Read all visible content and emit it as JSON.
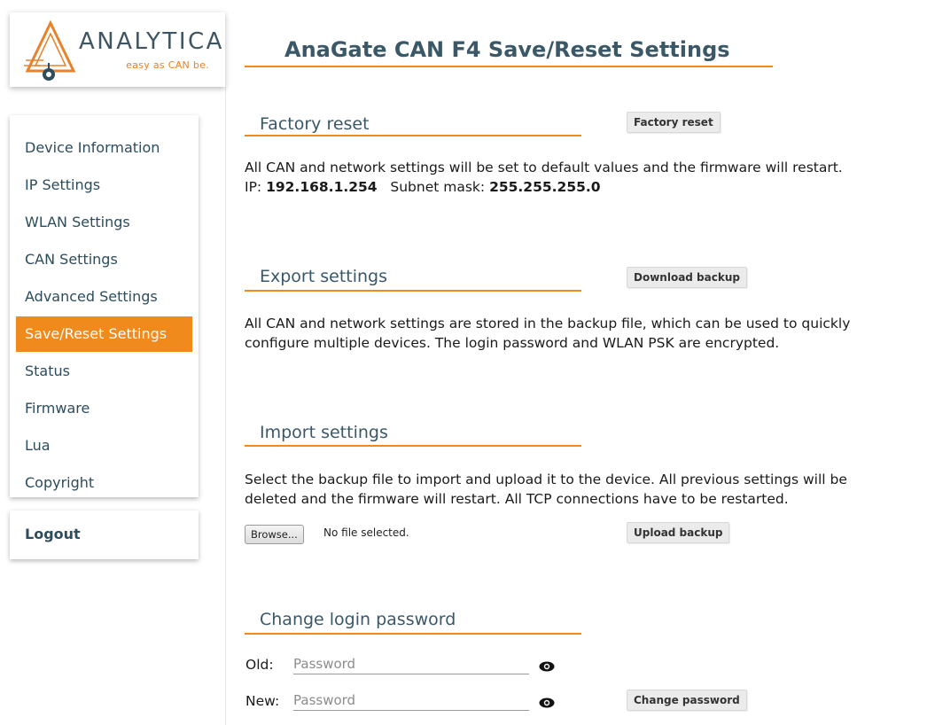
{
  "brand": {
    "name": "ANALYTICA",
    "slogan": "easy as CAN be.",
    "colors": {
      "accent": "#f08a1c",
      "heading": "#3a5868",
      "nav_text": "#2d4c5c"
    }
  },
  "sidebar": {
    "items": [
      {
        "label": "Device Information",
        "active": false
      },
      {
        "label": "IP Settings",
        "active": false
      },
      {
        "label": "WLAN Settings",
        "active": false
      },
      {
        "label": "CAN Settings",
        "active": false
      },
      {
        "label": "Advanced Settings",
        "active": false
      },
      {
        "label": "Save/Reset Settings",
        "active": true
      },
      {
        "label": "Status",
        "active": false
      },
      {
        "label": "Firmware",
        "active": false
      },
      {
        "label": "Lua",
        "active": false
      },
      {
        "label": "Copyright",
        "active": false
      }
    ],
    "logout_label": "Logout"
  },
  "page": {
    "title": "AnaGate CAN F4 Save/Reset Settings"
  },
  "factory_reset": {
    "heading": "Factory reset",
    "button": "Factory reset",
    "text": "All CAN and network settings will be set to default values and the firmware will restart.",
    "ip_label": "IP:",
    "ip_value": "192.168.1.254",
    "mask_label": "Subnet mask:",
    "mask_value": "255.255.255.0"
  },
  "export": {
    "heading": "Export settings",
    "button": "Download backup",
    "text": "All CAN and network settings are stored in the backup file, which can be used to quickly configure multiple devices. The login password and WLAN PSK are encrypted."
  },
  "import": {
    "heading": "Import settings",
    "text": "Select the backup file to import and upload it to the device. All previous settings will be deleted and the firmware will restart. All TCP connections have to be restarted.",
    "browse_label": "Browse...",
    "file_status": "No file selected.",
    "button": "Upload backup"
  },
  "password": {
    "heading": "Change login password",
    "old_label": "Old:",
    "new_label": "New:",
    "old_placeholder": "Password",
    "new_placeholder": "Password",
    "old_value": "",
    "new_value": "",
    "button": "Change password",
    "toggle_icon": "eye-icon"
  }
}
